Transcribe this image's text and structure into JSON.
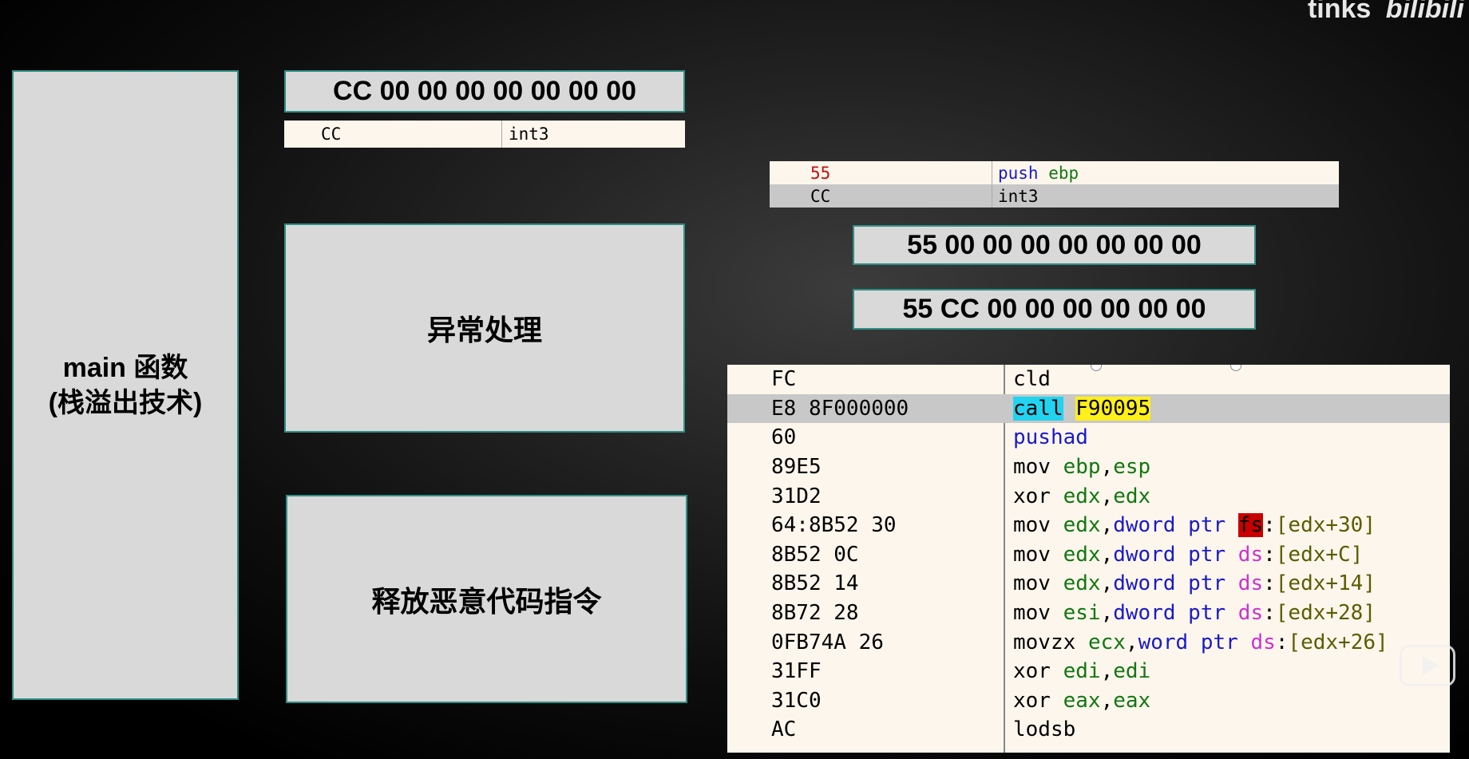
{
  "logo": {
    "text": "tinks",
    "brand": "bilibili"
  },
  "main_box": {
    "line1": "main 函数",
    "line2": "(栈溢出技术)"
  },
  "hex_top": "CC 00 00 00 00 00 00 00",
  "disasm_top": [
    {
      "bytes": "CC",
      "instr": "int3"
    }
  ],
  "box_exception": "异常处理",
  "box_payload": "释放恶意代码指令",
  "disasm_right_small": [
    {
      "bytes": "55",
      "instr_kw": "push",
      "instr_reg": "ebp"
    },
    {
      "bytes": "CC",
      "instr": "int3"
    }
  ],
  "hex_mid1": "55 00 00 00 00 00 00 00",
  "hex_mid2": "55 CC 00 00 00 00 00 00",
  "disasm_main": [
    {
      "bytes": "FC",
      "mn": "cld"
    },
    {
      "bytes": "E8 8F000000",
      "mn": "call",
      "target": "F90095"
    },
    {
      "bytes": "60",
      "mn": "pushad"
    },
    {
      "bytes": "89E5",
      "mn": "mov",
      "op1": "ebp",
      "op2": "esp"
    },
    {
      "bytes": "31D2",
      "mn": "xor",
      "op1": "edx",
      "op2": "edx"
    },
    {
      "bytes": "64:8B52 30",
      "mn": "mov",
      "op1": "edx",
      "size": "dword ptr",
      "seg": "fs",
      "mem": "[edx+30]"
    },
    {
      "bytes": "8B52 0C",
      "mn": "mov",
      "op1": "edx",
      "size": "dword ptr",
      "seg": "ds",
      "mem": "[edx+C]"
    },
    {
      "bytes": "8B52 14",
      "mn": "mov",
      "op1": "edx",
      "size": "dword ptr",
      "seg": "ds",
      "mem": "[edx+14]"
    },
    {
      "bytes": "8B72 28",
      "mn": "mov",
      "op1": "esi",
      "size": "dword ptr",
      "seg": "ds",
      "mem": "[edx+28]"
    },
    {
      "bytes": "0FB74A 26",
      "mn": "movzx",
      "op1": "ecx",
      "size": "word ptr",
      "seg": "ds",
      "mem": "[edx+26]"
    },
    {
      "bytes": "31FF",
      "mn": "xor",
      "op1": "edi",
      "op2": "edi"
    },
    {
      "bytes": "31C0",
      "mn": "xor",
      "op1": "eax",
      "op2": "eax"
    },
    {
      "bytes": "AC",
      "mn": "lodsb"
    }
  ],
  "colors": {
    "box_bg": "#d9d9d9",
    "box_border": "#2f8f86",
    "disasm_bg": "#fdf6ec",
    "selected_row": "#c8c8c8",
    "call_highlight": "#22d3f0",
    "target_highlight": "#ffef1a",
    "fs_highlight": "#c80000"
  }
}
